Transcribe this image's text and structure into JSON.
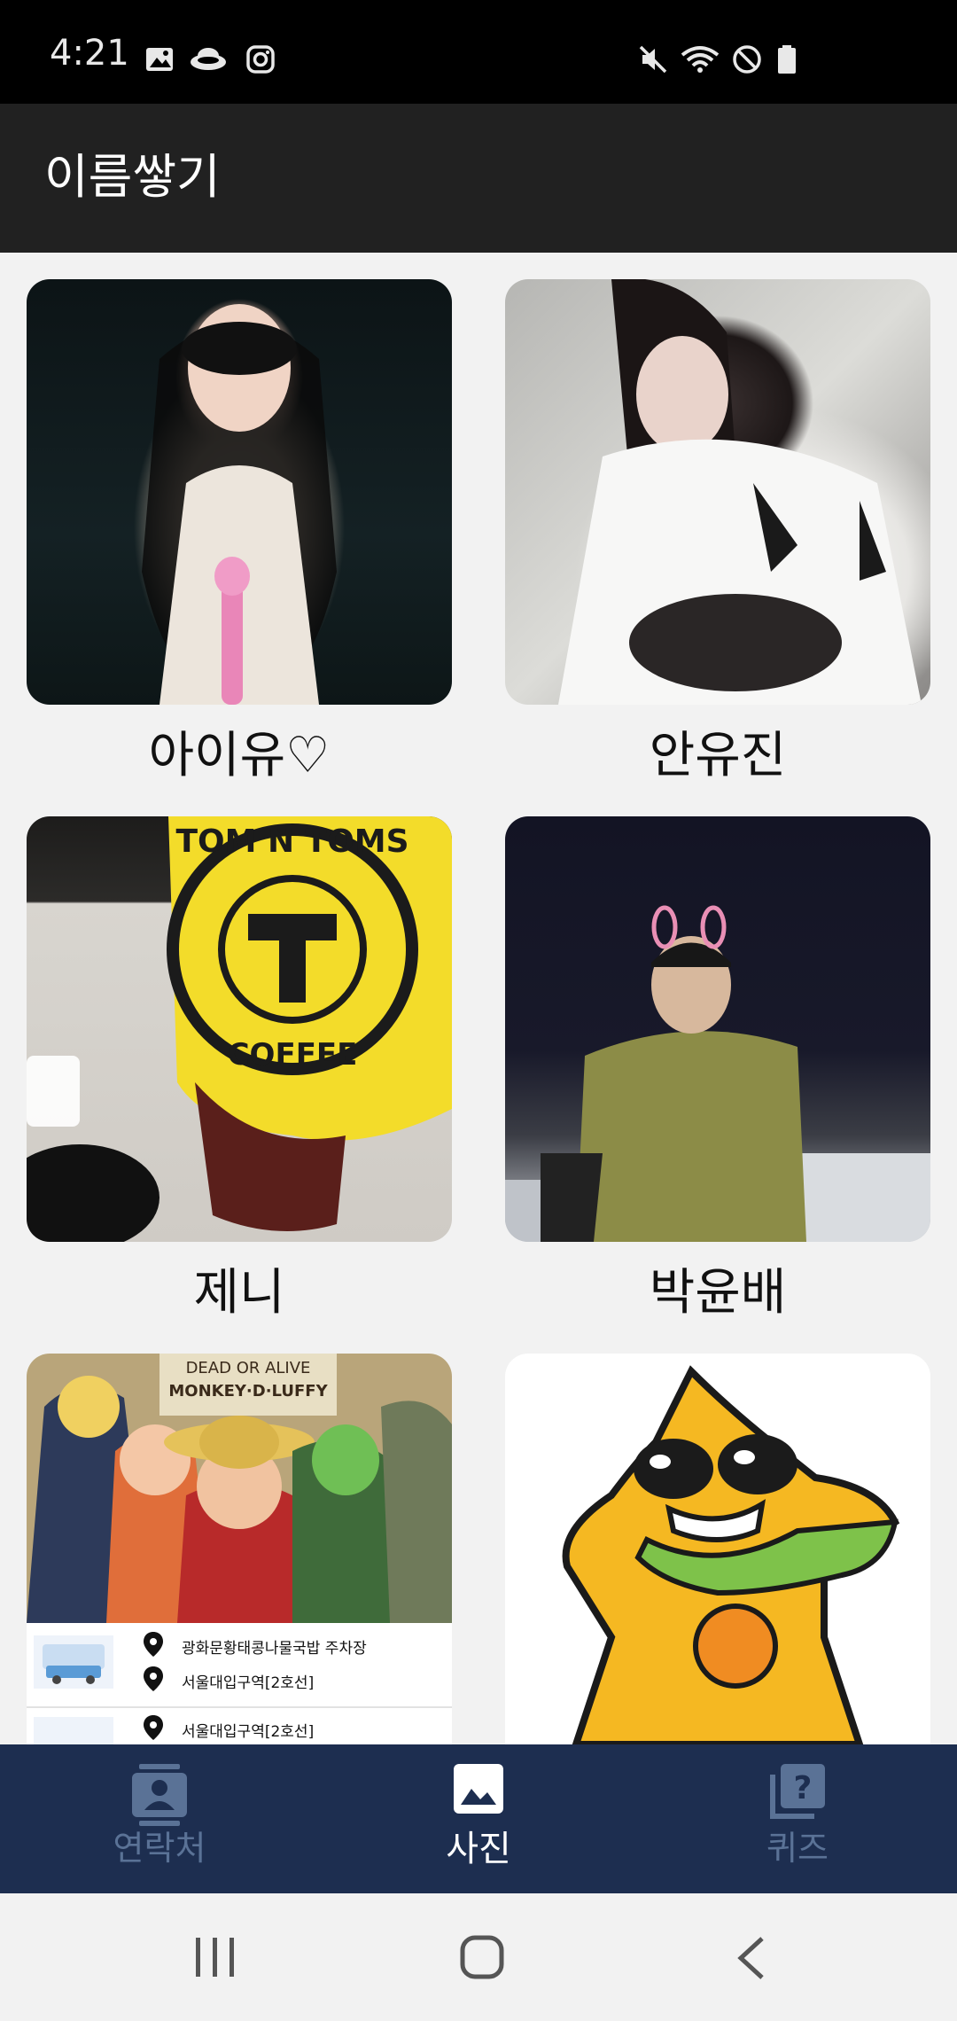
{
  "status_bar": {
    "time": "4:21",
    "left_icons": [
      "image-icon",
      "cloud-icon",
      "instagram-icon"
    ],
    "right_icons": [
      "mute-icon",
      "wifi-icon",
      "do-not-disturb-icon",
      "battery-icon"
    ]
  },
  "app_bar": {
    "title": "이름쌓기"
  },
  "gallery": {
    "items": [
      {
        "name": "아이유♡",
        "image": "concert-singer-photo"
      },
      {
        "name": "안유진",
        "image": "portrait-photo"
      },
      {
        "name": "제니",
        "image": "coffee-cup-photo"
      },
      {
        "name": "박윤배",
        "image": "night-portrait-photo"
      },
      {
        "name": "",
        "image": "anime-poster-screenshot"
      },
      {
        "name": "",
        "image": "yellow-star-character"
      }
    ],
    "poster_overlay": {
      "poster_texts": [
        "DEAD OR ALIVE",
        "MONKEY·D·LUFFY"
      ],
      "cup_text": [
        "TOM N TOMS",
        "COFFEE"
      ],
      "rows": [
        {
          "line1": "광화문황태콩나물국밥 주차장",
          "line2": "서울대입구역[2호선]"
        },
        {
          "line1": "서울대입구역[2호선]",
          "line2": ""
        }
      ]
    }
  },
  "bottom_nav": {
    "items": [
      {
        "label": "연락처",
        "icon": "contacts-icon",
        "active": false
      },
      {
        "label": "사진",
        "icon": "photo-icon",
        "active": true
      },
      {
        "label": "퀴즈",
        "icon": "quiz-icon",
        "active": false
      }
    ]
  },
  "system_nav": {
    "buttons": [
      "recent-apps-icon",
      "home-icon",
      "back-icon"
    ]
  },
  "colors": {
    "status_bar": "#000000",
    "app_bar": "#212121",
    "background": "#f2f2f2",
    "bottom_nav": "#1d2e50",
    "nav_active": "#ffffff",
    "nav_inactive": "#5a7296"
  }
}
